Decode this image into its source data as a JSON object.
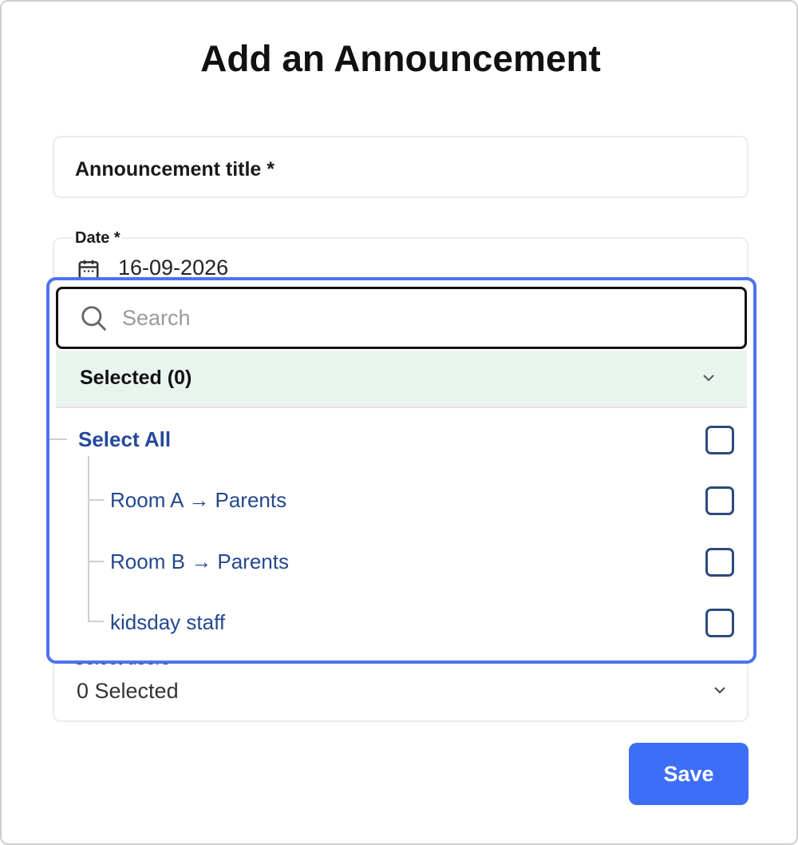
{
  "dialog": {
    "title": "Add an Announcement",
    "announcement_title_label": "Announcement title *",
    "date_label": "Date *",
    "date_value": "16-09-2026",
    "users_label": "Select users",
    "users_value": "0 Selected",
    "save_label": "Save"
  },
  "dropdown": {
    "search_placeholder": "Search",
    "selected_header": "Selected (0)",
    "select_all_label": "Select All",
    "items": [
      {
        "label": "Room A → Parents",
        "checked": false
      },
      {
        "label": "Room B → Parents",
        "checked": false
      },
      {
        "label": "kidsday staff",
        "checked": false
      }
    ]
  },
  "colors": {
    "accent": "#3d6ef5",
    "dropdown_border": "#4d72f0",
    "selected_header_bg": "#e9f4ee",
    "tree_label": "#24488f"
  },
  "icons": {
    "date": "calendar-icon",
    "search": "search-icon",
    "chevron": "chevron-down-icon"
  }
}
